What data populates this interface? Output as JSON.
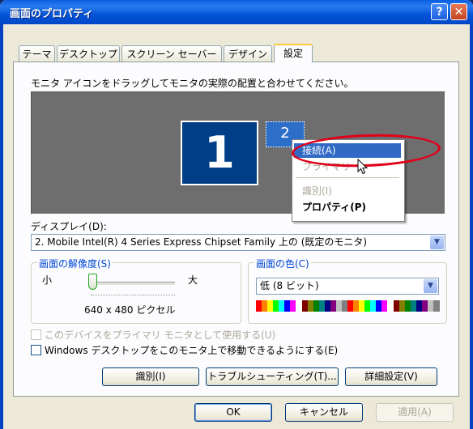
{
  "window": {
    "title": "画面のプロパティ",
    "help_label": "?",
    "close_label": "✕"
  },
  "tabs": [
    {
      "label": "テーマ"
    },
    {
      "label": "デスクトップ"
    },
    {
      "label": "スクリーン セーバー"
    },
    {
      "label": "デザイン"
    },
    {
      "label": "設定",
      "active": true
    }
  ],
  "instruction": "モニタ アイコンをドラッグしてモニタの実際の配置と合わせてください。",
  "monitors": {
    "primary": "1",
    "secondary": "2"
  },
  "context_menu": {
    "items": [
      {
        "label": "接続(A)",
        "state": "selected"
      },
      {
        "label": "プライマリ",
        "state": "disabled"
      },
      {
        "label": "識別(I)",
        "state": "disabled"
      },
      {
        "label": "プロパティ(P)",
        "state": "bold"
      }
    ]
  },
  "display": {
    "label": "ディスプレイ(D):",
    "value": "2. Mobile Intel(R) 4 Series Express Chipset Family 上の (既定のモニタ)"
  },
  "resolution": {
    "group_title": "画面の解像度(S)",
    "min_label": "小",
    "max_label": "大",
    "value": "640 x 480 ピクセル",
    "slider_fraction": 0
  },
  "color": {
    "group_title": "画面の色(C)",
    "value": "低 (8 ビット)",
    "palette": [
      "#ff0000",
      "#ff8000",
      "#ffff00",
      "#00ff00",
      "#00ffff",
      "#0000ff",
      "#ff00ff",
      "#ffffff",
      "#800000",
      "#808000",
      "#008000",
      "#008080",
      "#000080",
      "#800080",
      "#c0c0c0",
      "#808080",
      "#ff0000",
      "#ff8000",
      "#ffff00",
      "#00ff00",
      "#00ffff",
      "#0000ff",
      "#ff00ff",
      "#ffffff",
      "#800000",
      "#808000",
      "#008000",
      "#008080",
      "#000080",
      "#800080",
      "#c0c0c0",
      "#808080"
    ]
  },
  "checkboxes": [
    {
      "label": "このデバイスをプライマリ モニタとして使用する(U)",
      "disabled": true,
      "checked": false
    },
    {
      "label": "Windows デスクトップをこのモニタ上で移動できるようにする(E)",
      "disabled": false,
      "checked": false
    }
  ],
  "action_buttons": {
    "identify": "識別(I)",
    "troubleshoot": "トラブルシューティング(T)...",
    "advanced": "詳細設定(V)"
  },
  "footer_buttons": {
    "ok": "OK",
    "cancel": "キャンセル",
    "apply": "適用(A)"
  }
}
